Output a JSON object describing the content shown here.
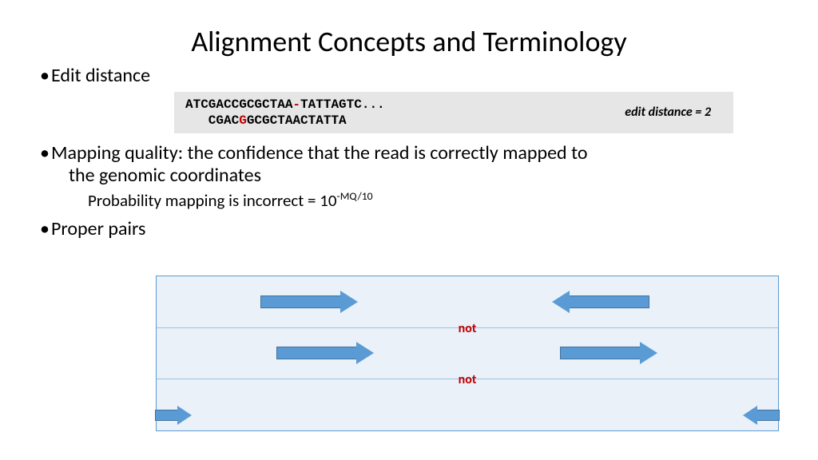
{
  "title": "Alignment Concepts and Terminology",
  "bullets": {
    "edit": "Edit distance",
    "mapq_line1": "Mapping quality: the confidence that the read is correctly mapped to",
    "mapq_line2": "the genomic coordinates",
    "mapq_sub_prefix": "Probability mapping is incorrect = 10",
    "mapq_sub_exp": "-MQ/10",
    "pairs": "Proper pairs"
  },
  "seq": {
    "line1_pre": "ATCGACCGCGCTAA",
    "line1_gap": "-",
    "line1_post": "TATTAGTC...",
    "line2_pre": "   CGAC",
    "line2_mid": "G",
    "line2_post": "GCGCTAACTATTA",
    "note": "edit distance = 2"
  },
  "diagram": {
    "not": "not"
  }
}
